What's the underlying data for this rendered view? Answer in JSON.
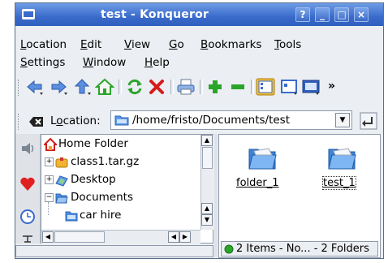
{
  "window": {
    "title": "test - Konqueror",
    "help_label": "?",
    "minimize_label": "_",
    "maximize_label": "□",
    "close_label": "×"
  },
  "menu": [
    {
      "label": "Location",
      "u": "L",
      "rest": "ocation"
    },
    {
      "label": "Edit",
      "u": "E",
      "rest": "dit"
    },
    {
      "label": "View",
      "u": "V",
      "rest": "iew"
    },
    {
      "label": "Go",
      "u": "G",
      "rest": "o"
    },
    {
      "label": "Bookmarks",
      "u": "B",
      "rest": "ookmarks"
    },
    {
      "label": "Tools",
      "u": "T",
      "rest": "ools"
    },
    {
      "label": "Settings",
      "u": "S",
      "rest": "ettings"
    },
    {
      "label": "Window",
      "u": "W",
      "rest": "indow"
    },
    {
      "label": "Help",
      "u": "H",
      "rest": "elp"
    }
  ],
  "toolbar": {
    "overflow_label": "»"
  },
  "location": {
    "label_pre": "L",
    "label_u": "o",
    "label_post": "cation:",
    "path": "/home/fristo/Documents/test"
  },
  "tree": [
    {
      "label": "Home Folder"
    },
    {
      "label": "class1.tar.gz"
    },
    {
      "label": "Desktop"
    },
    {
      "label": "Documents"
    },
    {
      "label": "car hire"
    }
  ],
  "files": [
    {
      "name": "folder_1"
    },
    {
      "name": "test_1"
    }
  ],
  "status": {
    "text": "2 Items - No... - 2 Folders"
  },
  "colors": {
    "title_bar": "#3a6bcc",
    "folder_blue": "#4a8ee0",
    "accent_green": "#2aa52a"
  }
}
